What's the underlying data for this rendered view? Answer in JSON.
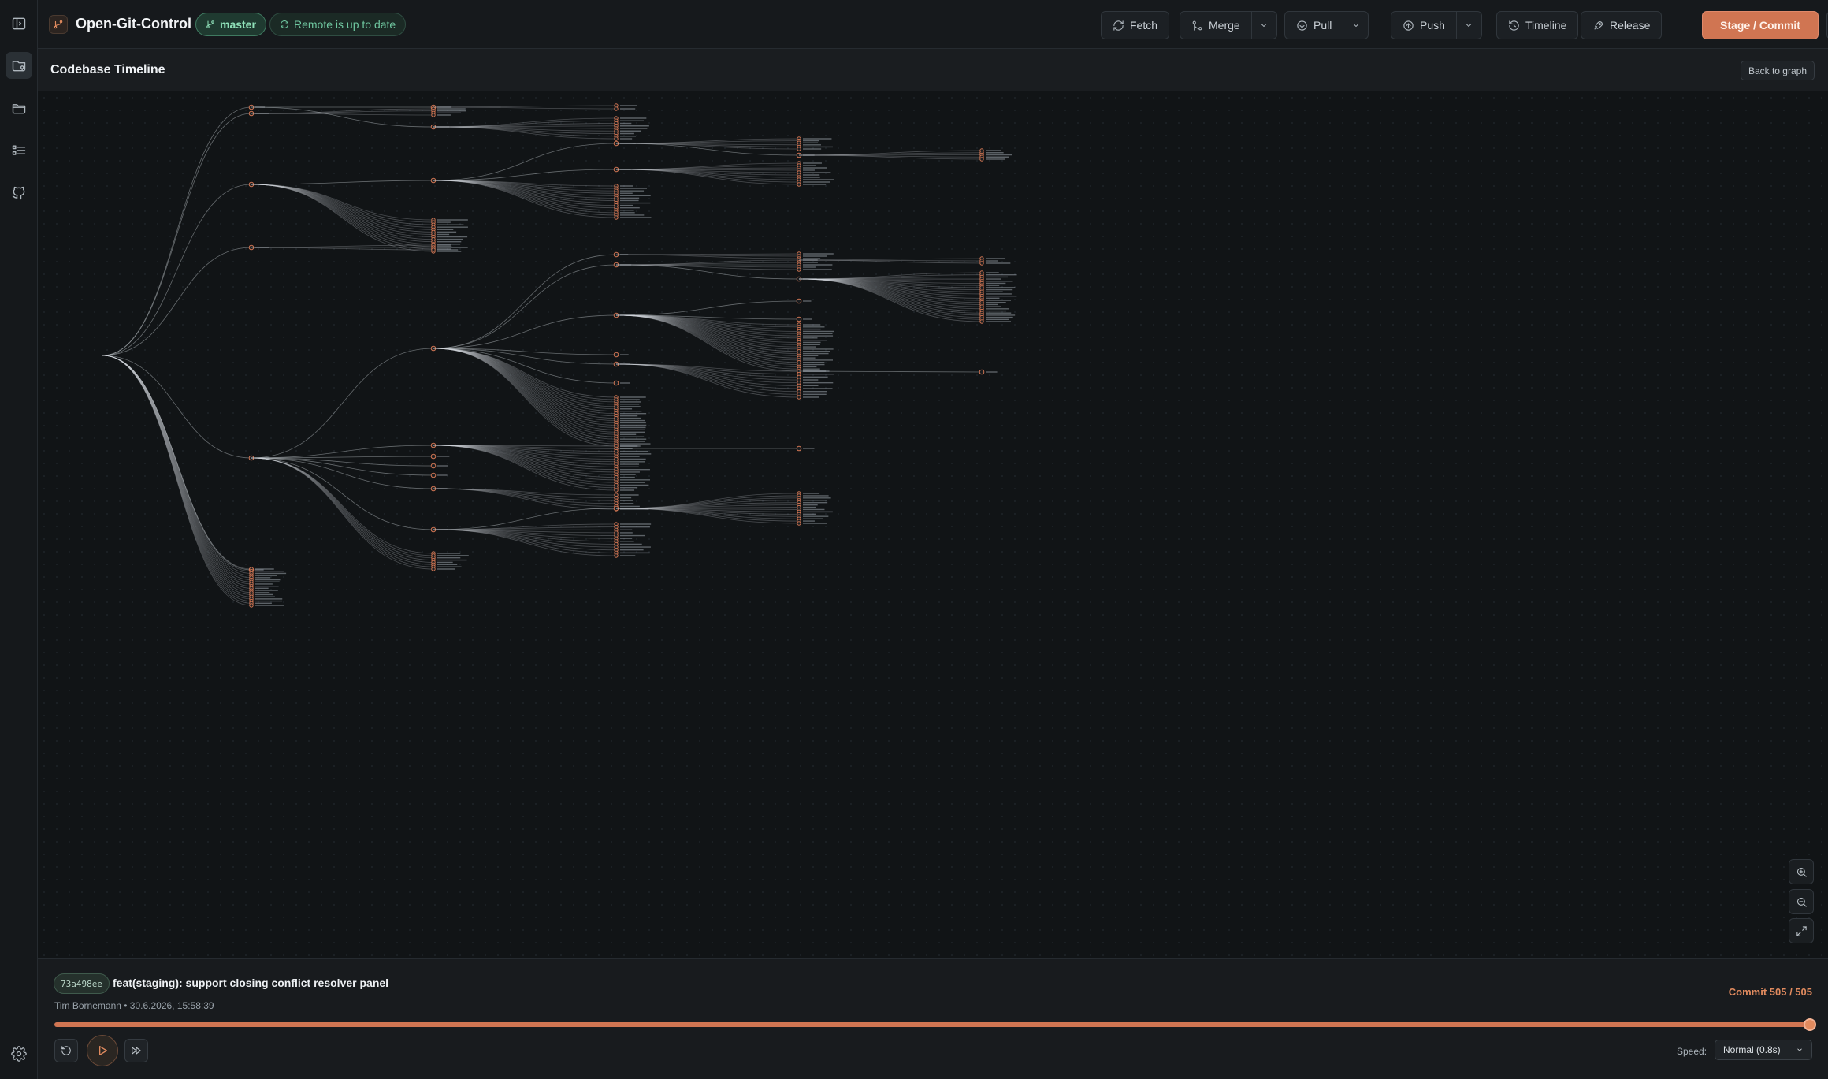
{
  "app": {
    "title": "Open-Git-Control"
  },
  "branch": {
    "name": "master"
  },
  "remote_status": {
    "label": "Remote is up to date"
  },
  "toolbar": {
    "fetch_label": "Fetch",
    "merge_label": "Merge",
    "pull_label": "Pull",
    "push_label": "Push",
    "timeline_label": "Timeline",
    "release_label": "Release",
    "commit_label": "Stage / Commit"
  },
  "view": {
    "title": "Codebase Timeline",
    "back_label": "Back to graph"
  },
  "sidebar": {
    "items": [
      {
        "icon": "sidebar-toggle-icon"
      },
      {
        "icon": "repository-icon"
      },
      {
        "icon": "folder-icon"
      },
      {
        "icon": "list-icon"
      },
      {
        "icon": "git-branch-icon"
      }
    ]
  },
  "zoom": {
    "in_icon": "zoom-in-icon",
    "out_icon": "zoom-out-icon",
    "fit_icon": "fit-icon"
  },
  "commit": {
    "hash": "73a498ee",
    "message": "feat(staging): support closing conflict resolver panel",
    "author_date": "Tim Bornemann • 30.6.2026, 15:58:39",
    "counter": "Commit 505 / 505",
    "progress": 1.0
  },
  "playback": {
    "speed_label": "Speed:",
    "speed_value": "Normal (0.8s)"
  },
  "colors": {
    "accent": "#d07552",
    "branch_green": "#8fe0b8",
    "background": "#111416"
  }
}
